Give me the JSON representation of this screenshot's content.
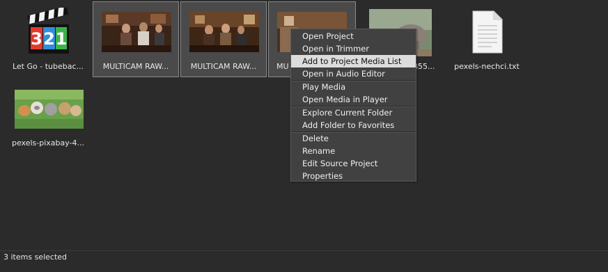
{
  "browser": {
    "items": [
      {
        "label": "Let Go - tubebac...",
        "selected": false,
        "icon": "media-player-classic-321-icon"
      },
      {
        "label": "MULTICAM RAW...",
        "selected": true,
        "icon": "video-thumbnail"
      },
      {
        "label": "MULTICAM RAW...",
        "selected": true,
        "icon": "video-thumbnail"
      },
      {
        "label": "MU",
        "selected": true,
        "icon": "video-thumbnail"
      },
      {
        "label": "855...",
        "selected": false,
        "icon": "elephant-image-thumbnail"
      },
      {
        "label": "pexels-nechci.txt",
        "selected": false,
        "icon": "text-file-icon"
      },
      {
        "label": "pexels-pixabay-4...",
        "selected": false,
        "icon": "kittens-image-thumbnail"
      }
    ]
  },
  "context_menu": {
    "items": [
      {
        "label": "Open Project"
      },
      {
        "label": "Open in Trimmer"
      },
      {
        "label": "Add to Project Media List",
        "hovered": true
      },
      {
        "label": "Open in Audio Editor"
      },
      {
        "label": "Play Media"
      },
      {
        "label": "Open Media in Player"
      },
      {
        "label": "Explore Current Folder"
      },
      {
        "label": "Add Folder to Favorites"
      },
      {
        "label": "Delete"
      },
      {
        "label": "Rename"
      },
      {
        "label": "Edit Source Project"
      },
      {
        "label": "Properties"
      }
    ]
  },
  "status": {
    "text": "3 items selected"
  },
  "colors": {
    "background": "#2b2b2b",
    "selected_tile": "#4a4a4a",
    "menu_background": "#414141",
    "menu_hover": "#dcdcdc"
  }
}
